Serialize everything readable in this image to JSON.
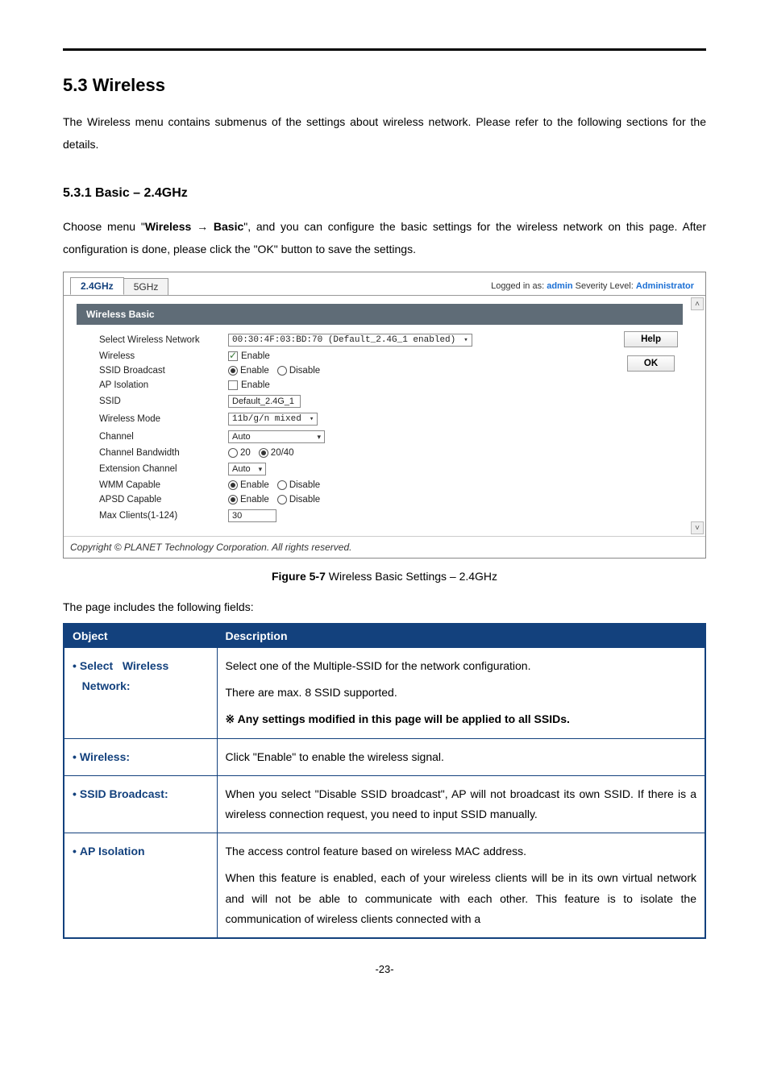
{
  "section": {
    "number_title": "5.3  Wireless",
    "intro": "The Wireless menu contains submenus of the settings about wireless network. Please refer to the following sections for the details.",
    "sub_number_title": "5.3.1  Basic – 2.4GHz",
    "sub_intro_a": "Choose menu \"",
    "sub_intro_b": "Wireless",
    "sub_intro_arrow": " → ",
    "sub_intro_c": "Basic",
    "sub_intro_d": "\", and you can configure the basic settings for the wireless network on this page. After configuration is done, please click the \"OK\" button to save the settings."
  },
  "screenshot": {
    "tab1": "2.4GHz",
    "tab2": "5GHz",
    "logged_in_label": "Logged in as: ",
    "logged_in_user": "admin",
    "severity_label": "   Severity Level: ",
    "severity_value": "Administrator",
    "panel_title": "Wireless Basic",
    "help_btn": "Help",
    "ok_btn": "OK",
    "rows": {
      "select_label": "Select Wireless Network",
      "select_value": "00:30:4F:03:BD:70 (Default_2.4G_1 enabled)",
      "wireless_label": "Wireless",
      "wireless_opt": "Enable",
      "ssid_bc_label": "SSID Broadcast",
      "enable_opt": "Enable",
      "disable_opt": "Disable",
      "ap_iso_label": "AP Isolation",
      "ssid_label": "SSID",
      "ssid_value": "Default_2.4G_1",
      "mode_label": "Wireless Mode",
      "mode_value": "11b/g/n mixed",
      "channel_label": "Channel",
      "channel_value": "Auto",
      "cbw_label": "Channel Bandwidth",
      "cbw_opt1": "20",
      "cbw_opt2": "20/40",
      "ext_label": "Extension Channel",
      "ext_value": "Auto",
      "wmm_label": "WMM Capable",
      "apsd_label": "APSD Capable",
      "max_label": "Max Clients(1-124)",
      "max_value": "30"
    },
    "copyright": "Copyright © PLANET Technology Corporation. All rights reserved."
  },
  "figure": {
    "label": "Figure 5-7",
    "text": " Wireless Basic Settings – 2.4GHz"
  },
  "fields_intro": "The page includes the following fields:",
  "table": {
    "col1": "Object",
    "col2": "Description",
    "rows": [
      {
        "obj_a": "Select",
        "obj_b": "Wireless",
        "obj_c": "Network:",
        "desc_lines": [
          "Select one of the Multiple-SSID for the network configuration.",
          "There are max. 8 SSID supported.",
          "※ Any settings modified in this page will be applied to all SSIDs."
        ],
        "bold_last": true
      },
      {
        "obj": "Wireless:",
        "desc_lines": [
          "Click \"Enable\" to enable the wireless signal."
        ]
      },
      {
        "obj": "SSID Broadcast:",
        "desc_lines": [
          "When you select \"Disable SSID broadcast\", AP will not broadcast its own SSID. If there is a wireless connection request, you need to input SSID manually."
        ]
      },
      {
        "obj": "AP Isolation",
        "desc_lines": [
          "The access control feature based on wireless MAC address.",
          "When this feature is enabled, each of your wireless clients will be in its own virtual network and will not be able to communicate with each other. This feature is to isolate the communication of wireless clients connected with a"
        ]
      }
    ]
  },
  "page_number": "-23-"
}
